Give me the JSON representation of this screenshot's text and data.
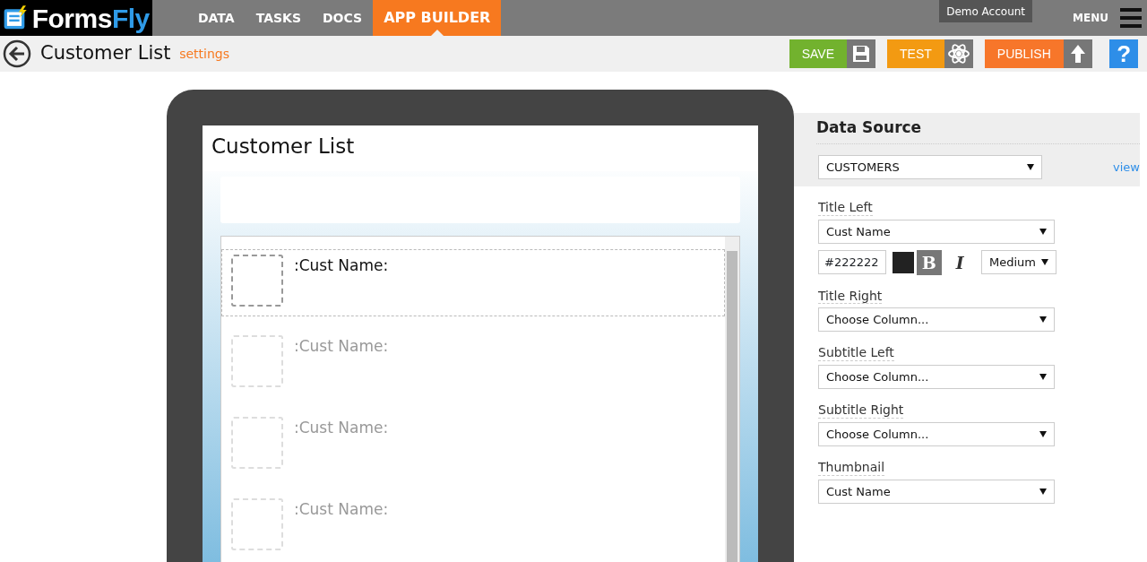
{
  "logo": {
    "text": "Forms",
    "accent": "Fly"
  },
  "nav": [
    {
      "label": "DATA",
      "selected": false
    },
    {
      "label": "TASKS",
      "selected": false
    },
    {
      "label": "DOCS",
      "selected": false
    },
    {
      "label": "APP BUILDER",
      "selected": true
    }
  ],
  "account": "Demo Account",
  "menu": "MENU",
  "page": {
    "title": "Customer List",
    "settings": "settings"
  },
  "actions": [
    {
      "label": "SAVE",
      "kind": "save",
      "color": "#72b22e"
    },
    {
      "label": "TEST",
      "kind": "test",
      "color": "#f39a12"
    },
    {
      "label": "PUBLISH",
      "kind": "publish",
      "color": "#f7762a"
    }
  ],
  "help": "?",
  "preview": {
    "title": "Customer List",
    "items": [
      {
        "text": ":Cust Name:",
        "selected": true
      },
      {
        "text": ":Cust Name:",
        "selected": false
      },
      {
        "text": ":Cust Name:",
        "selected": false
      },
      {
        "text": ":Cust Name:",
        "selected": false
      }
    ]
  },
  "panel": {
    "heading": "Data Source",
    "source": "CUSTOMERS",
    "view": "view",
    "fields": [
      {
        "label": "Title Left",
        "value": "Cust Name",
        "color": "#222222",
        "bold": true,
        "bold_label": "B",
        "italic": false,
        "italic_label": "I",
        "size": "Medium"
      },
      {
        "label": "Title Right",
        "value": "Choose Column..."
      },
      {
        "label": "Subtitle Left",
        "value": "Choose Column..."
      },
      {
        "label": "Subtitle Right",
        "value": "Choose Column..."
      },
      {
        "label": "Thumbnail",
        "value": "Cust Name"
      }
    ]
  }
}
